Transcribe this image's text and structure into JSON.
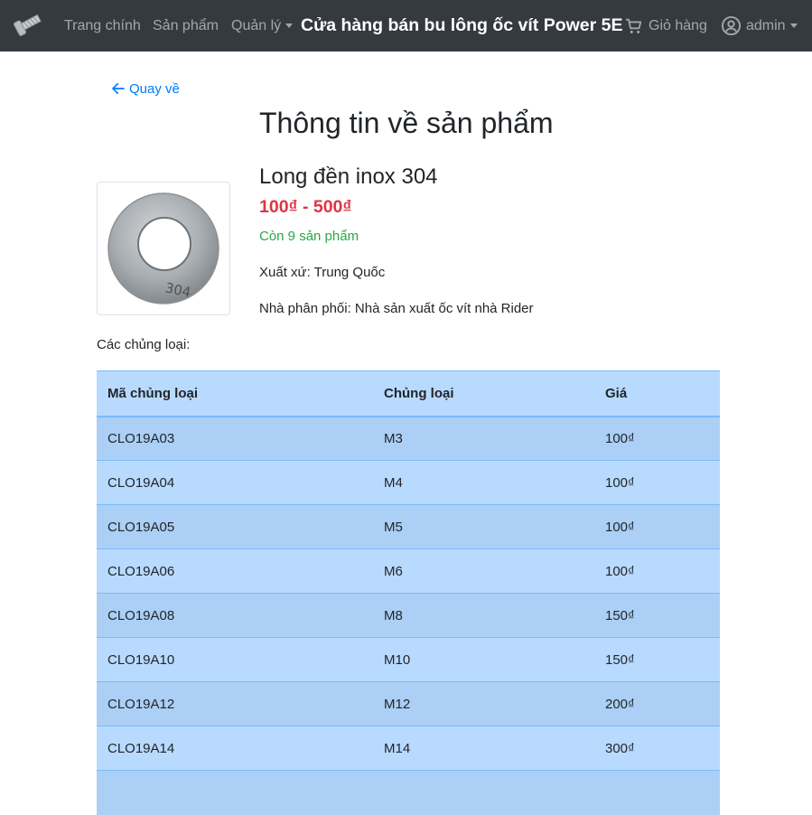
{
  "navbar": {
    "logo_icon": "bolt-screw-icon",
    "home_label": "Trang chính",
    "products_label": "Sản phẩm",
    "manage_label": "Quản lý",
    "store_title": "Cửa hàng bán bu lông ốc vít Power 5E",
    "cart_icon": "cart-icon",
    "cart_label": "Giỏ hàng",
    "user_icon": "user-circle-icon",
    "user_label": "admin"
  },
  "back": {
    "icon": "arrow-left-icon",
    "label": "Quay về"
  },
  "page_title": "Thông tin về sản phẩm",
  "product": {
    "name": "Long đền inox 304",
    "price": "100₫ - 500₫",
    "stock": "Còn 9 sản phẩm",
    "origin": "Xuất xứ: Trung Quốc",
    "distributor": "Nhà phân phối: Nhà sản xuất ốc vít nhà Rider",
    "image_text": "304"
  },
  "variants": {
    "label": "Các chủng loại:",
    "headers": [
      "Mã chủng loại",
      "Chủng loại",
      "Giá"
    ],
    "rows": [
      [
        "CLO19A03",
        "M3",
        "100₫"
      ],
      [
        "CLO19A04",
        "M4",
        "100₫"
      ],
      [
        "CLO19A05",
        "M5",
        "100₫"
      ],
      [
        "CLO19A06",
        "M6",
        "100₫"
      ],
      [
        "CLO19A08",
        "M8",
        "150₫"
      ],
      [
        "CLO19A10",
        "M10",
        "150₫"
      ],
      [
        "CLO19A12",
        "M12",
        "200₫"
      ],
      [
        "CLO19A14",
        "M14",
        "300₫"
      ],
      [
        "",
        "",
        ""
      ]
    ]
  },
  "colors": {
    "navbar_bg": "#343a40",
    "link": "#007bff",
    "price": "#dc3545",
    "stock": "#28a745",
    "table_bg": "#b8daff",
    "table_border": "#7abaff"
  }
}
